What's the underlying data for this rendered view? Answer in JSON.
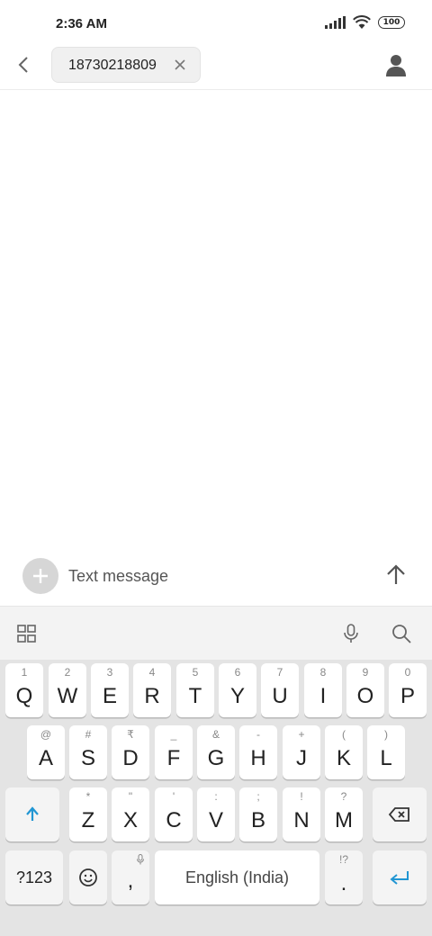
{
  "status_bar": {
    "time": "2:36 AM",
    "battery": "100",
    "icons": [
      "signal-icon",
      "wifi-icon",
      "battery-icon"
    ]
  },
  "header": {
    "recipient": "18730218809",
    "icons": [
      "back-arrow-icon",
      "close-icon",
      "contact-person-icon"
    ]
  },
  "compose": {
    "placeholder": "Text message",
    "icons": [
      "plus-icon",
      "send-arrow-icon"
    ]
  },
  "keyboard_toolbar": {
    "icons": [
      "apps-grid-icon",
      "microphone-icon",
      "search-icon"
    ]
  },
  "keyboard": {
    "row1": [
      {
        "main": "Q",
        "sub": "1"
      },
      {
        "main": "W",
        "sub": "2"
      },
      {
        "main": "E",
        "sub": "3"
      },
      {
        "main": "R",
        "sub": "4"
      },
      {
        "main": "T",
        "sub": "5"
      },
      {
        "main": "Y",
        "sub": "6"
      },
      {
        "main": "U",
        "sub": "7"
      },
      {
        "main": "I",
        "sub": "8"
      },
      {
        "main": "O",
        "sub": "9"
      },
      {
        "main": "P",
        "sub": "0"
      }
    ],
    "row2": [
      {
        "main": "A",
        "sub": "@"
      },
      {
        "main": "S",
        "sub": "#"
      },
      {
        "main": "D",
        "sub": "₹"
      },
      {
        "main": "F",
        "sub": "_"
      },
      {
        "main": "G",
        "sub": "&"
      },
      {
        "main": "H",
        "sub": "-"
      },
      {
        "main": "J",
        "sub": "+"
      },
      {
        "main": "K",
        "sub": "("
      },
      {
        "main": "L",
        "sub": ")"
      }
    ],
    "row3": [
      {
        "main": "Z",
        "sub": "*"
      },
      {
        "main": "X",
        "sub": "\""
      },
      {
        "main": "C",
        "sub": "'"
      },
      {
        "main": "V",
        "sub": ":"
      },
      {
        "main": "B",
        "sub": ";"
      },
      {
        "main": "N",
        "sub": "!"
      },
      {
        "main": "M",
        "sub": "?"
      }
    ],
    "symbols_key": "?123",
    "comma_key": ",",
    "space_key": "English (India)",
    "period_key": ".",
    "period_sub": "!?",
    "special_icons": [
      "shift-icon",
      "backspace-icon",
      "emoji-icon",
      "enter-icon"
    ],
    "accent_color": "#2196d3"
  }
}
